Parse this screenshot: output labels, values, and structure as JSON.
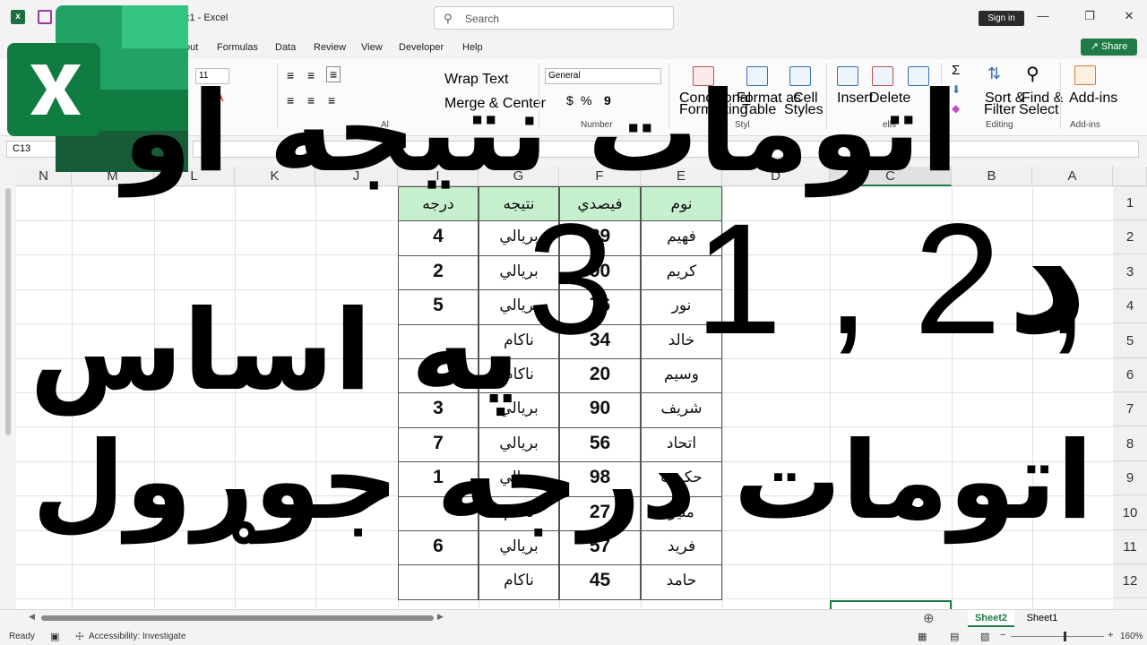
{
  "window": {
    "title": "x1 - Excel",
    "search_placeholder": "Search",
    "signin_label": "Sign in",
    "share_label": "Share"
  },
  "menu": [
    "out",
    "Formulas",
    "Data",
    "Review",
    "View",
    "Developer",
    "Help"
  ],
  "ribbon": {
    "font_size": "11",
    "wrap_text": "Wrap Text",
    "merge_center": "Merge & Center",
    "number_format": "General",
    "group_number": "Number",
    "group_editing": "Editing",
    "group_addins": "Add-ins",
    "conditional": "Conditional",
    "conditional_2": "Formatting",
    "format_as": "Format as",
    "format_as_2": "Table",
    "cell": "Cell",
    "styles": "Styles",
    "insert": "Insert",
    "delete": "Delete",
    "sort": "Sort &",
    "sort_2": "Filter",
    "find": "Find &",
    "find_2": "Select",
    "addins": "Add-ins",
    "al": "Al",
    "styl": "Styl",
    "ells": "ells",
    "currency": "$",
    "percent": "%",
    "comma": "9",
    "auto_sum": "Σ",
    "fill_color": "A"
  },
  "name_box": "C13",
  "columns": [
    "N",
    "M",
    "L",
    "K",
    "J",
    "I",
    "G",
    "F",
    "E",
    "D",
    "C",
    "B",
    "A"
  ],
  "rows": [
    "1",
    "2",
    "3",
    "4",
    "5",
    "6",
    "7",
    "8",
    "9",
    "10",
    "11",
    "12"
  ],
  "table": {
    "headers": [
      "درجه",
      "نتيجه",
      "فيصدي",
      "نوم"
    ],
    "rows": [
      [
        "4",
        "بريالي",
        "89",
        "فهيم"
      ],
      [
        "2",
        "بريالي",
        "90",
        "كريم"
      ],
      [
        "5",
        "بريالي",
        "76",
        "نور"
      ],
      [
        "",
        "ناکام",
        "34",
        "خالد"
      ],
      [
        "",
        "ناکام",
        "20",
        "وسيم"
      ],
      [
        "3",
        "بريالي",
        "90",
        "شريف"
      ],
      [
        "7",
        "بريالي",
        "56",
        "اتحاد"
      ],
      [
        "1",
        "بريالي",
        "98",
        "حكمت"
      ],
      [
        "",
        "ناکام",
        "27",
        "منير"
      ],
      [
        "6",
        "بريالي",
        "57",
        "فريد"
      ],
      [
        "",
        "ناکام",
        "45",
        "حامد"
      ]
    ]
  },
  "overlay": {
    "line1": "اتومات نتيجه او",
    "line2_d": "د",
    "line2_numbers": "1 , 2 ,",
    "line2_3": "3",
    "line3": "په اساس",
    "line4": "اتومات درجه جوړول"
  },
  "sheets": {
    "active": "Sheet2",
    "other": "Sheet1"
  },
  "status": {
    "ready": "Ready",
    "accessibility": "Accessibility: Investigate",
    "zoom": "160%"
  }
}
